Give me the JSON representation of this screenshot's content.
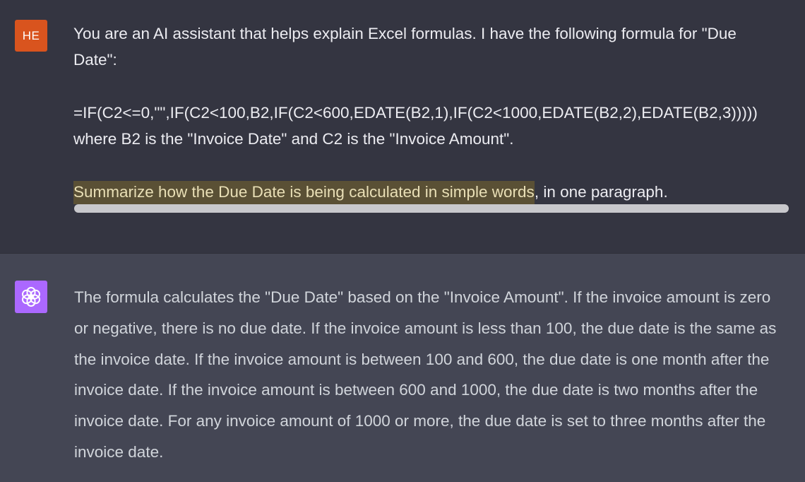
{
  "user": {
    "avatar_initials": "HE",
    "avatar_color": "#d9541e",
    "line1": "You are an AI assistant that helps explain Excel formulas. I have the following formula for \"Due",
    "line2": "Date\":",
    "formula": "=IF(C2<=0,\"\",IF(C2<100,B2,IF(C2<600,EDATE(B2,1),IF(C2<1000,EDATE(B2,2),EDATE(B2,3)))))",
    "line_where": "where B2 is the \"Invoice Date\" and C2 is the \"Invoice Amount\".",
    "highlighted_text": "Summarize how the Due Date is being calculated in simple words",
    "rest_text": ", in one paragraph.",
    "highlight_color": "#5a5035"
  },
  "assistant": {
    "avatar_icon": "openai-logo-icon",
    "avatar_color": "#ab68ff",
    "response": "The formula calculates the \"Due Date\" based on the \"Invoice Amount\". If the invoice amount is zero or negative, there is no due date. If the invoice amount is less than 100, the due date is the same as the invoice date. If the invoice amount is between 100 and 600, the due date is one month after the invoice date. If the invoice amount is between 600 and 1000, the due date is two months after the invoice date. For any invoice amount of 1000 or more, the due date is set to three months after the invoice date."
  }
}
